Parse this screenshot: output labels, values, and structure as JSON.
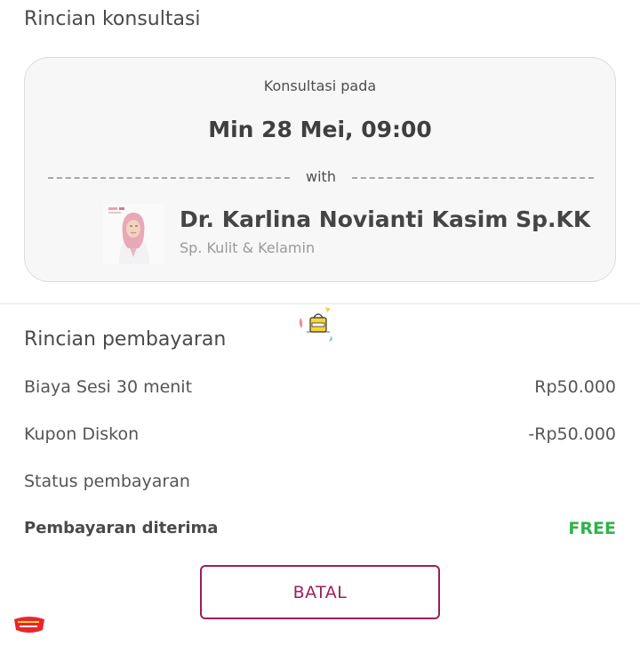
{
  "consultation": {
    "title": "Rincian konsultasi",
    "label": "Konsultasi pada",
    "datetime": "Min 28 Mei, 09:00",
    "with_label": "with",
    "doctor": {
      "name": "Dr. Karlina Novianti Kasim Sp.KK",
      "specialty": "Sp. Kulit & Kelamin"
    }
  },
  "payment": {
    "title": "Rincian pembayaran",
    "rows": [
      {
        "label": "Biaya Sesi 30 menit",
        "value": "Rp50.000"
      },
      {
        "label": "Kupon Diskon",
        "value": "-Rp50.000"
      },
      {
        "label": "Status pembayaran",
        "value": ""
      },
      {
        "label": "Pembayaran diterima",
        "value": "FREE"
      }
    ]
  },
  "actions": {
    "cancel_label": "BATAL"
  },
  "colors": {
    "accent": "#9c1f5c",
    "free": "#2fb34a"
  },
  "icons": {
    "sticker": "shopping-bag-sticker-icon",
    "sale_badge": "sale-badge-icon"
  }
}
